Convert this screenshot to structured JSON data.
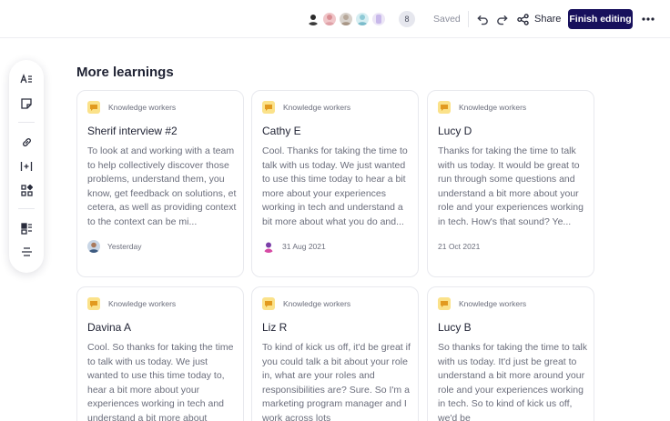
{
  "topbar": {
    "collaborators": [
      "avatar-1",
      "avatar-2",
      "avatar-3",
      "avatar-4",
      "avatar-5"
    ],
    "extra_count": "8",
    "status": "Saved",
    "share_label": "Share",
    "finish_label": "Finish editing"
  },
  "toolbar": {
    "tools": [
      "text-style-icon",
      "sticky-note-icon",
      "link-icon",
      "insert-divider-icon",
      "shapes-icon",
      "template-icon",
      "section-divider-icon"
    ]
  },
  "section": {
    "title": "More learnings"
  },
  "cards": [
    {
      "tag": "Knowledge workers",
      "title": "Sherif interview #2",
      "body": "To look at and working with a team to help collectively discover those problems, understand them, you know, get feedback on solutions, et cetera, as well as providing context to the context can be mi...",
      "date": "Yesterday",
      "avatar": "man-avatar"
    },
    {
      "tag": "Knowledge workers",
      "title": "Cathy E",
      "body": "Cool. Thanks for taking the time to talk with us today. We just wanted to use this time today to hear a bit more about your experiences working in tech and understand a bit more about what you do and...",
      "date": "31 Aug 2021",
      "avatar": "woman-avatar"
    },
    {
      "tag": "Knowledge workers",
      "title": "Lucy D",
      "body": "Thanks for taking the time to talk with us today. It would be great to run through some questions and understand a bit more about your role and your experiences working in tech. How's that sound? Ye...",
      "date": "21 Oct 2021",
      "avatar": ""
    },
    {
      "tag": "Knowledge workers",
      "title": "Davina A",
      "body": "Cool. So thanks for taking the time to talk with us today. We just wanted to use this time today to, hear a bit more about your experiences working in tech and understand a bit more about"
    },
    {
      "tag": "Knowledge workers",
      "title": "Liz R",
      "body": "To kind of kick us off, it'd be great if you could talk a bit about your role in, what are your roles and responsibilities are? Sure. So I'm a marketing program manager and I work across lots"
    },
    {
      "tag": "Knowledge workers",
      "title": "Lucy B",
      "body": "So thanks for taking the time to talk with us today. It'd just be great to understand a bit more around your role and your experiences working in tech. So to kind of kick us off, we'd be"
    }
  ]
}
